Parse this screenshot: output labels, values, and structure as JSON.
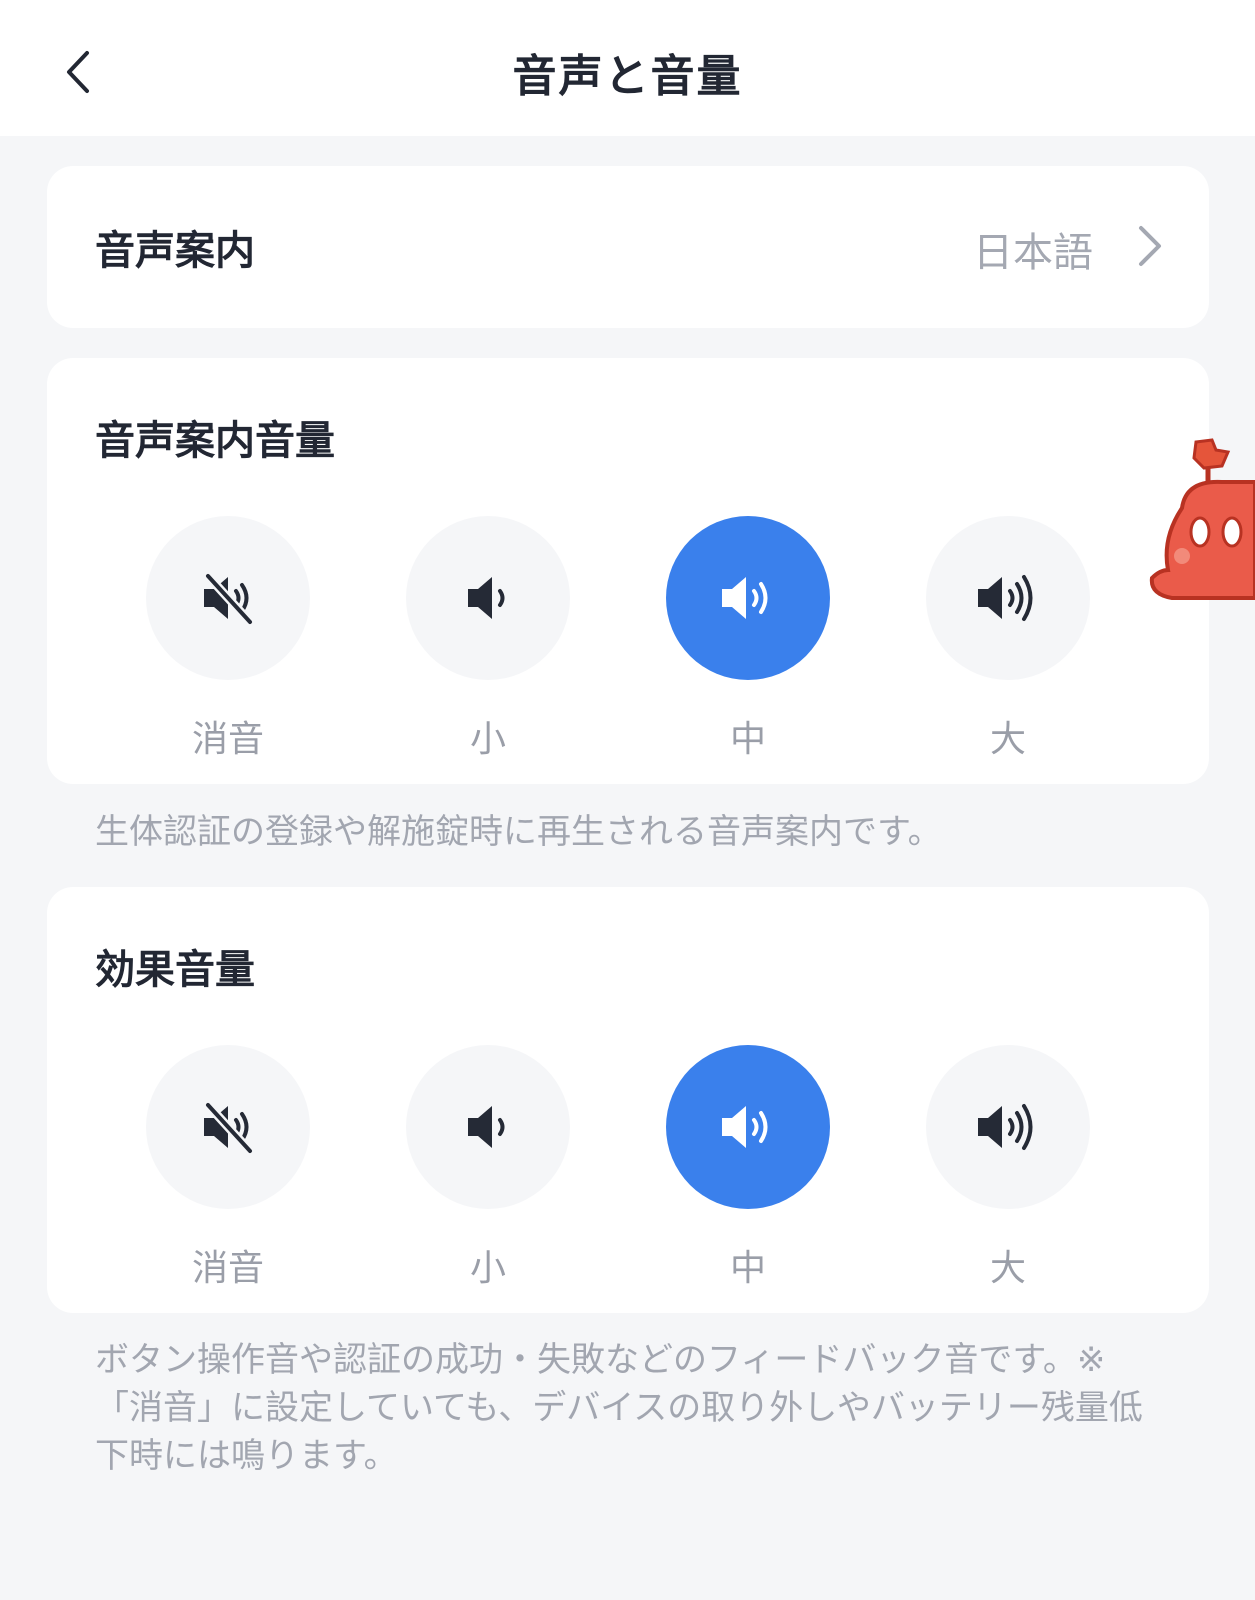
{
  "header": {
    "title": "音声と音量"
  },
  "voice_guide": {
    "label": "音声案内",
    "value": "日本語"
  },
  "voice_volume": {
    "title": "音声案内音量",
    "options": [
      "消音",
      "小",
      "中",
      "大"
    ],
    "selected": "中",
    "note": "生体認証の登録や解施錠時に再生される音声案内です。"
  },
  "effect_volume": {
    "title": "効果音量",
    "options": [
      "消音",
      "小",
      "中",
      "大"
    ],
    "selected": "中",
    "note": "ボタン操作音や認証の成功・失敗などのフィードバック音です。※「消音」に設定していても、デバイスの取り外しやバッテリー残量低下時には鳴ります。"
  },
  "icons": [
    "back-icon",
    "chevron-right-icon",
    "speaker-mute-icon",
    "speaker-low-icon",
    "speaker-medium-icon",
    "speaker-high-icon",
    "mascot-icon"
  ],
  "colors": {
    "accent": "#3a80ec",
    "background": "#f5f6f8",
    "card": "#ffffff",
    "muted_text": "#a2a6b0"
  }
}
